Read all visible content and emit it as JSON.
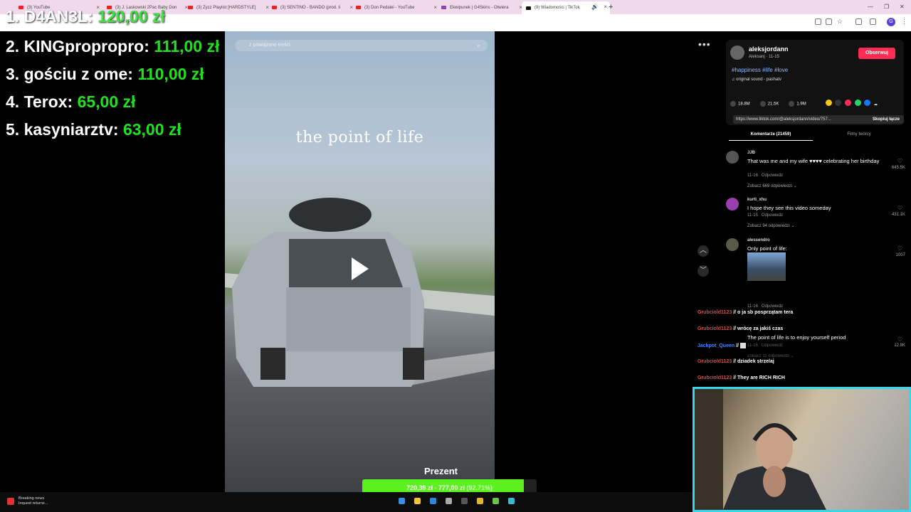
{
  "browser": {
    "tabs": [
      {
        "label": "(3) YouTube",
        "favicon_color": "#e22222"
      },
      {
        "label": "(3) J. Laskowski 2Pac Baby Don",
        "favicon_color": "#e22222"
      },
      {
        "label": "(3) Zyzz Playlist [HARDSTYLE]",
        "favicon_color": "#e22222"
      },
      {
        "label": "(3) SENTINO - BANDO (prod. li",
        "favicon_color": "#e22222"
      },
      {
        "label": "(3) Don Pedalei - YouTube",
        "favicon_color": "#e22222"
      },
      {
        "label": "Ekwipunek | G4Skins - Otwiera",
        "favicon_color": "#8e44ad"
      },
      {
        "label": "(9) Wiadomości | TikTok",
        "favicon_color": "#111111"
      }
    ],
    "url": "...?lang=pl-PL",
    "profile_initial": "G"
  },
  "donations": [
    {
      "rank": "1.",
      "name": "D4AN3L:",
      "amount": "120,00 zł"
    },
    {
      "rank": "2.",
      "name": "KINGpropropro:",
      "amount": "111,00 zł"
    },
    {
      "rank": "3.",
      "name": "gościu z ome:",
      "amount": "110,00 zł"
    },
    {
      "rank": "4.",
      "name": "Terox:",
      "amount": "65,00 zł"
    },
    {
      "rank": "5.",
      "name": "kasyniarztv:",
      "amount": "63,00 zł"
    }
  ],
  "video": {
    "search_placeholder": "ż powiązane treści",
    "caption": "the point of life"
  },
  "tiktok": {
    "username": "aleksjordann",
    "subline": "Aleksanj · 11-15",
    "follow_label": "Obserwuj",
    "hashtags": "#happiness #life #love",
    "sound": "original sound - pashatv",
    "stats": {
      "likes": "18.8M",
      "comments": "21.5K",
      "saves": "1.9M"
    },
    "share_colors": [
      "#f5c518",
      "#333333",
      "#fe2c55",
      "#25d366",
      "#1877f2"
    ],
    "link": "https://www.tiktok.com/@aleksjordann/video/757...",
    "copy_label": "Skopiuj łącze",
    "tab_comments": "Komentarze (21459)",
    "tab_creator": "Filmy twórcy",
    "comments": [
      {
        "user": "JJB",
        "text": "That was me and my wife ♥♥♥♥ celebrating her birthday",
        "date": "11-16",
        "reply": "Odpowiedz",
        "likes": "645.5K",
        "more": "Zobacz 669 odpowiedzi ⌄"
      },
      {
        "user": "kurti_xhu",
        "text": "I hope they see this video someday",
        "date": "11-15",
        "reply": "Odpowiedz",
        "likes": "431.1K",
        "more": "Zobacz 94 odpowiedzi ⌄"
      },
      {
        "user": "alessendro",
        "text": "Only point of life:",
        "date": "11-16",
        "reply": "Odpowiedz",
        "likes": "1007",
        "more": ""
      },
      {
        "user": "",
        "text": "The point of life is to enjoy yourself period",
        "date": "11-16",
        "reply": "Odpowiedz",
        "likes": "12.8K",
        "more": "Zobacz 11 odpowiedzi ⌄"
      }
    ]
  },
  "chat": [
    {
      "user": "Grubciold1123",
      "msg": "o ja sb posprzątam tera"
    },
    {
      "user": "Grubciold1123",
      "msg": "wrócę za jakiś czas"
    },
    {
      "user": "Jackpot_Queen",
      "msg": ""
    },
    {
      "user": "Grubciold1123",
      "msg": "dziadek strzelaj"
    },
    {
      "user": "Grubciold1123",
      "msg": "They are RICH RICH"
    }
  ],
  "goal": {
    "label": "Prezent",
    "current": "720,39 zł",
    "sep": " - ",
    "target": "777,00 zł",
    "percent": "(92.71%)",
    "fraction": 0.9271
  },
  "taskbar": {
    "news_line1": "Breaking news",
    "news_line2": "Inquest returns..."
  }
}
